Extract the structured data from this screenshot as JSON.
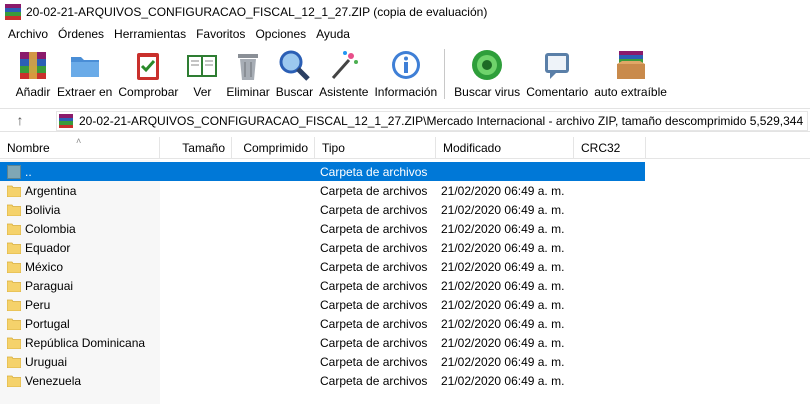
{
  "window": {
    "title": "20-02-21-ARQUIVOS_CONFIGURACAO_FISCAL_12_1_27.ZIP (copia de evaluación)"
  },
  "menu": {
    "items": [
      "Archivo",
      "Órdenes",
      "Herramientas",
      "Favoritos",
      "Opciones",
      "Ayuda"
    ]
  },
  "toolbar": {
    "buttons": [
      {
        "label": "Añadir",
        "icon": "add-archive-icon"
      },
      {
        "label": "Extraer en",
        "icon": "extract-folder-icon"
      },
      {
        "label": "Comprobar",
        "icon": "test-clipboard-icon"
      },
      {
        "label": "Ver",
        "icon": "view-book-icon"
      },
      {
        "label": "Eliminar",
        "icon": "trash-icon"
      },
      {
        "label": "Buscar",
        "icon": "magnifier-icon"
      },
      {
        "label": "Asistente",
        "icon": "wizard-wand-icon"
      },
      {
        "label": "Información",
        "icon": "info-icon"
      },
      {
        "label": "Buscar virus",
        "icon": "virus-scan-icon"
      },
      {
        "label": "Comentario",
        "icon": "comment-icon"
      },
      {
        "label": "auto extraíble",
        "icon": "sfx-box-icon"
      }
    ]
  },
  "address": {
    "path": "20-02-21-ARQUIVOS_CONFIGURACAO_FISCAL_12_1_27.ZIP\\Mercado Internacional - archivo ZIP, tamaño descomprimido 5,529,344 bytes"
  },
  "columns": {
    "name": "Nombre",
    "size": "Tamaño",
    "packed": "Comprimido",
    "type": "Tipo",
    "modified": "Modificado",
    "crc": "CRC32"
  },
  "rows": [
    {
      "name": "..",
      "type": "Carpeta de archivos",
      "modified": "",
      "selected": true
    },
    {
      "name": "Argentina",
      "type": "Carpeta de archivos",
      "modified": "21/02/2020 06:49 a. m."
    },
    {
      "name": "Bolivia",
      "type": "Carpeta de archivos",
      "modified": "21/02/2020 06:49 a. m."
    },
    {
      "name": "Colombia",
      "type": "Carpeta de archivos",
      "modified": "21/02/2020 06:49 a. m."
    },
    {
      "name": "Equador",
      "type": "Carpeta de archivos",
      "modified": "21/02/2020 06:49 a. m."
    },
    {
      "name": "México",
      "type": "Carpeta de archivos",
      "modified": "21/02/2020 06:49 a. m."
    },
    {
      "name": "Paraguai",
      "type": "Carpeta de archivos",
      "modified": "21/02/2020 06:49 a. m."
    },
    {
      "name": "Peru",
      "type": "Carpeta de archivos",
      "modified": "21/02/2020 06:49 a. m."
    },
    {
      "name": "Portugal",
      "type": "Carpeta de archivos",
      "modified": "21/02/2020 06:49 a. m."
    },
    {
      "name": "República Dominicana",
      "type": "Carpeta de archivos",
      "modified": "21/02/2020 06:49 a. m."
    },
    {
      "name": "Uruguai",
      "type": "Carpeta de archivos",
      "modified": "21/02/2020 06:49 a. m."
    },
    {
      "name": "Venezuela",
      "type": "Carpeta de archivos",
      "modified": "21/02/2020 06:49 a. m."
    }
  ],
  "colors": {
    "selection": "#0078d7",
    "folder": "#f5d26b"
  }
}
